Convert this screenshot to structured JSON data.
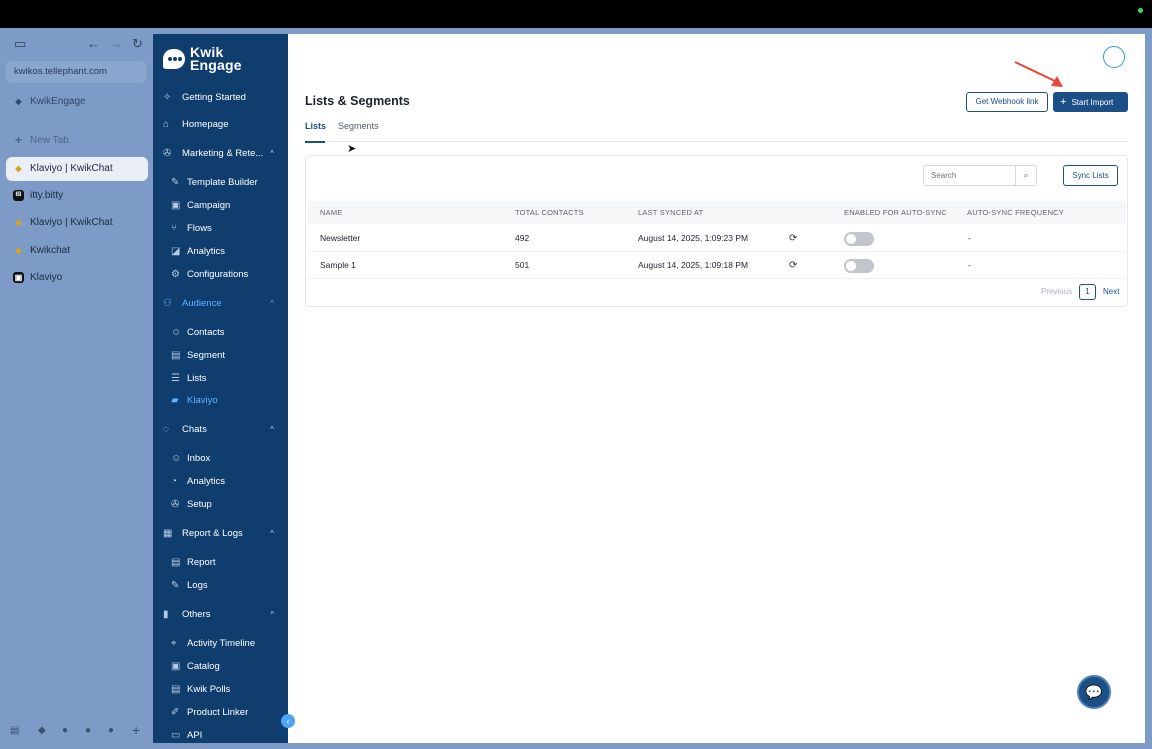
{
  "browser": {
    "url": "kwikos.tellephant.com",
    "pinned_label": "KwikEngage",
    "new_tab_label": "New Tab",
    "tabs": [
      {
        "label": "Klaviyo | KwikChat",
        "icon": "kwikchat-favicon",
        "fav": "◆",
        "active": true
      },
      {
        "label": "itty.bitty",
        "icon": "ib-favicon",
        "fav": "IB",
        "active": false
      },
      {
        "label": "Klaviyo | KwikChat",
        "icon": "kwikchat-favicon",
        "fav": "◆",
        "active": false
      },
      {
        "label": "Kwikchat",
        "icon": "kwikchat-favicon",
        "fav": "◆",
        "active": false
      },
      {
        "label": "Klaviyo",
        "icon": "klaviyo-favicon",
        "fav": "▣",
        "active": false
      }
    ]
  },
  "brand": {
    "line1": "Kwik",
    "line2": "Engage"
  },
  "sidebar": {
    "getting_started": "Getting Started",
    "homepage": "Homepage",
    "marketing": "Marketing & Rete...",
    "marketing_items": [
      "Template Builder",
      "Campaign",
      "Flows",
      "Analytics",
      "Configurations"
    ],
    "audience": "Audience",
    "audience_items": [
      "Contacts",
      "Segment",
      "Lists",
      "Klaviyo"
    ],
    "chats": "Chats",
    "chats_items": [
      "Inbox",
      "Analytics",
      "Setup"
    ],
    "report_logs": "Report & Logs",
    "report_items": [
      "Report",
      "Logs"
    ],
    "others": "Others",
    "others_items": [
      "Activity Timeline",
      "Catalog",
      "Kwik Polls",
      "Product Linker",
      "API"
    ]
  },
  "header": {
    "title": "Lists & Segments",
    "webhook_button": "Get Webhook link",
    "import_button": "Start Import"
  },
  "tabs": {
    "lists": "Lists",
    "segments": "Segments"
  },
  "toolbar": {
    "search_placeholder": "Search",
    "sync_button": "Sync Lists"
  },
  "table": {
    "columns": [
      "NAME",
      "TOTAL CONTACTS",
      "LAST SYNCED AT",
      "ENABLED FOR AUTO-SYNC",
      "AUTO-SYNC FREQUENCY"
    ],
    "rows": [
      {
        "name": "Newsletter",
        "total": "492",
        "last_synced": "August 14, 2025, 1:09:23 PM",
        "auto_sync": false,
        "frequency": "-"
      },
      {
        "name": "Sample 1",
        "total": "501",
        "last_synced": "August 14, 2025, 1:09:18 PM",
        "auto_sync": false,
        "frequency": "-"
      }
    ]
  },
  "pagination": {
    "previous": "Previous",
    "page": "1",
    "next": "Next"
  },
  "colors": {
    "sidebar_bg": "#0f3d6e",
    "primary": "#1b4f85",
    "accent": "#5eb2ff",
    "annotation_arrow": "#e8483a"
  }
}
